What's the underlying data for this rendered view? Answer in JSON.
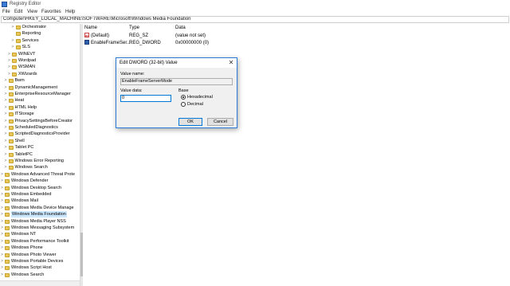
{
  "window": {
    "title": "Registry Editor",
    "accent": "#3b7bd4"
  },
  "menu": [
    "File",
    "Edit",
    "View",
    "Favorites",
    "Help"
  ],
  "address": "Computer\\HKEY_LOCAL_MACHINE\\SOFTWARE\\Microsoft\\Windows Media Foundation",
  "tree": [
    {
      "label": "Orchestrator",
      "depth": 3,
      "expander": ">"
    },
    {
      "label": "Reporting",
      "depth": 3,
      "expander": ""
    },
    {
      "label": "Services",
      "depth": 3,
      "expander": ">"
    },
    {
      "label": "SLS",
      "depth": 3,
      "expander": ">"
    },
    {
      "label": "WINEVT",
      "depth": 2,
      "expander": ">"
    },
    {
      "label": "Wordpad",
      "depth": 2,
      "expander": ">"
    },
    {
      "label": "WSMAN",
      "depth": 2,
      "expander": ">"
    },
    {
      "label": "XWizards",
      "depth": 2,
      "expander": ">"
    },
    {
      "label": "Bwm",
      "depth": 1,
      "expander": ">"
    },
    {
      "label": "DynamicManagement",
      "depth": 1,
      "expander": ">"
    },
    {
      "label": "EnterpriseResourceManager",
      "depth": 1,
      "expander": ">"
    },
    {
      "label": "Heat",
      "depth": 1,
      "expander": ">"
    },
    {
      "label": "HTML Help",
      "depth": 1,
      "expander": ">"
    },
    {
      "label": "ITStorage",
      "depth": 1,
      "expander": ">"
    },
    {
      "label": "PrivacySettingsBeforeCreator",
      "depth": 1,
      "expander": ">"
    },
    {
      "label": "ScheduledDiagnostics",
      "depth": 1,
      "expander": ">"
    },
    {
      "label": "ScriptedDiagnosticsProvider",
      "depth": 1,
      "expander": ">"
    },
    {
      "label": "Shell",
      "depth": 1,
      "expander": ">"
    },
    {
      "label": "Tablet PC",
      "depth": 1,
      "expander": ">"
    },
    {
      "label": "TabletPC",
      "depth": 1,
      "expander": ">"
    },
    {
      "label": "Windows Error Reporting",
      "depth": 1,
      "expander": ">"
    },
    {
      "label": "Windows Search",
      "depth": 1,
      "expander": ">"
    },
    {
      "label": "Windows Advanced Threat Prote",
      "depth": 0,
      "expander": ">"
    },
    {
      "label": "Windows Defender",
      "depth": 0,
      "expander": ">"
    },
    {
      "label": "Windows Desktop Search",
      "depth": 0,
      "expander": ">"
    },
    {
      "label": "Windows Embedded",
      "depth": 0,
      "expander": ">"
    },
    {
      "label": "Windows Mail",
      "depth": 0,
      "expander": ">"
    },
    {
      "label": "Windows Media Device Manage",
      "depth": 0,
      "expander": ">"
    },
    {
      "label": "Windows Media Foundation",
      "depth": 0,
      "expander": ">",
      "selected": true
    },
    {
      "label": "Windows Media Player NSS",
      "depth": 0,
      "expander": ">"
    },
    {
      "label": "Windows Messaging Subsystem",
      "depth": 0,
      "expander": ">"
    },
    {
      "label": "Windows NT",
      "depth": 0,
      "expander": ">"
    },
    {
      "label": "Windows Performance Toolkit",
      "depth": 0,
      "expander": ">"
    },
    {
      "label": "Windows Phone",
      "depth": 0,
      "expander": ">"
    },
    {
      "label": "Windows Photo Viewer",
      "depth": 0,
      "expander": ">"
    },
    {
      "label": "Windows Portable Devices",
      "depth": 0,
      "expander": ">"
    },
    {
      "label": "Windows Script Host",
      "depth": 0,
      "expander": ">"
    },
    {
      "label": "Windows Search",
      "depth": 0,
      "expander": ">"
    }
  ],
  "list": {
    "columns": [
      "Name",
      "Type",
      "Data"
    ],
    "rows": [
      {
        "name": "(Default)",
        "type": "REG_SZ",
        "data": "(value not set)",
        "icon": "string-value-icon"
      },
      {
        "name": "EnableFrameSer...",
        "type": "REG_DWORD",
        "data": "0x00000000 (0)",
        "icon": "binary-value-icon"
      }
    ]
  },
  "dialog": {
    "title": "Edit DWORD (32-bit) Value",
    "close_glyph": "✕",
    "value_name_label": "Value name:",
    "value_name": "EnableFrameServerMode",
    "value_data_label": "Value data:",
    "value_data": "0",
    "base_label": "Base",
    "base_options": [
      "Hexadecimal",
      "Decimal"
    ],
    "base_selected": "Hexadecimal",
    "ok_label": "OK",
    "cancel_label": "Cancel"
  }
}
